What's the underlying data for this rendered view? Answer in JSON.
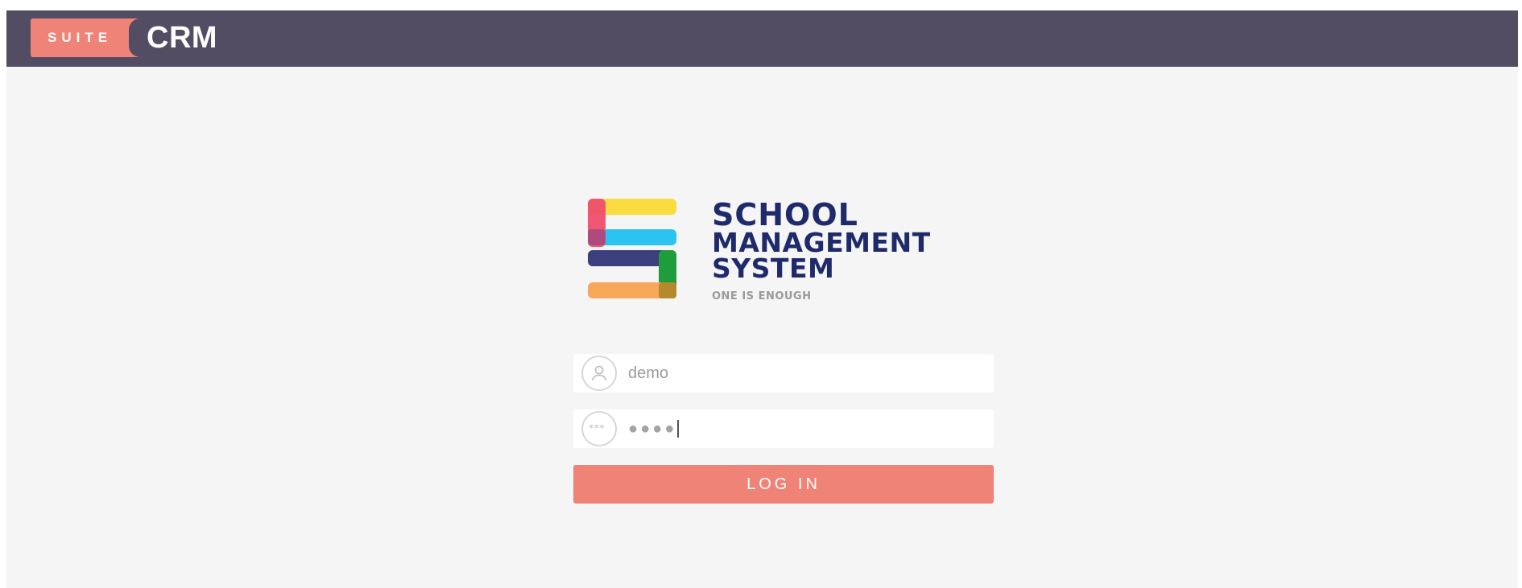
{
  "header": {
    "brand_suite": "SUITE",
    "brand_crm": "CRM"
  },
  "logo": {
    "line1": "SCHOOL",
    "line2": "MANAGEMENT",
    "line3": "SYSTEM",
    "tagline": "ONE IS ENOUGH"
  },
  "login": {
    "username_value": "demo",
    "password_masked": "●●●●",
    "button_label": "LOG IN"
  },
  "colors": {
    "header_bg": "#534d64",
    "accent": "#f08377",
    "logo_text": "#1f2a6b"
  },
  "icons": {
    "user": "user-icon",
    "password": "password-icon"
  }
}
